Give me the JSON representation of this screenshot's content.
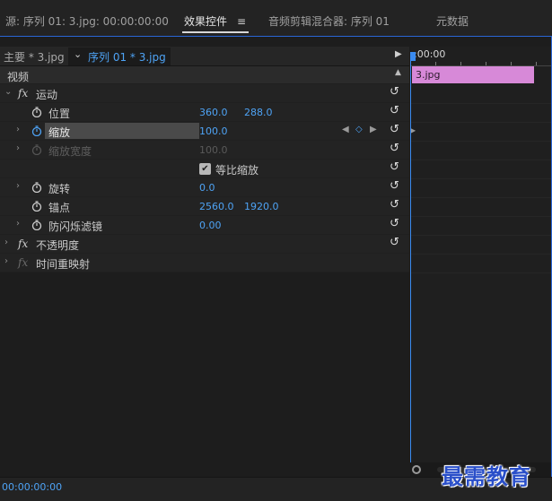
{
  "tabs": {
    "source": "源: 序列 01: 3.jpg: 00:00:00:00",
    "effects": "效果控件",
    "effects_menu": "≡",
    "mixer": "音频剪辑混合器: 序列 01",
    "metadata": "元数据"
  },
  "header": {
    "master": "主要 * 3.jpg",
    "sequence": "序列 01 * 3.jpg"
  },
  "effects": {
    "video_label": "视频",
    "motion": "运动",
    "position": {
      "label": "位置",
      "x": "360.0",
      "y": "288.0"
    },
    "scale": {
      "label": "缩放",
      "value": "100.0"
    },
    "scale_width": {
      "label": "缩放宽度",
      "value": "100.0"
    },
    "uniform_scale": {
      "label": "等比缩放",
      "checked": true
    },
    "rotation": {
      "label": "旋转",
      "value": "0.0"
    },
    "anchor": {
      "label": "锚点",
      "x": "2560.0",
      "y": "1920.0"
    },
    "flicker": {
      "label": "防闪烁滤镜",
      "value": "0.00"
    },
    "opacity": "不透明度",
    "time_remap": "时间重映射"
  },
  "timeline": {
    "timecode": ":00:00",
    "clip_name": "3.jpg"
  },
  "footer": {
    "timecode": "00:00:00:00"
  },
  "watermark": "最需教育",
  "colors": {
    "accent_blue": "#4ea3f5",
    "clip_pink": "#d789d8",
    "frame_blue": "#2a66d6"
  }
}
